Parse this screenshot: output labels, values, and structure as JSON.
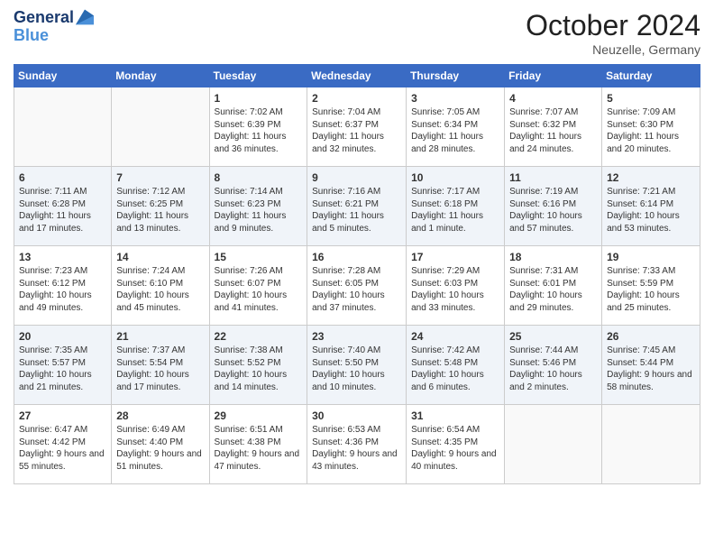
{
  "header": {
    "logo_line1": "General",
    "logo_line2": "Blue",
    "month": "October 2024",
    "location": "Neuzelle, Germany"
  },
  "weekdays": [
    "Sunday",
    "Monday",
    "Tuesday",
    "Wednesday",
    "Thursday",
    "Friday",
    "Saturday"
  ],
  "weeks": [
    [
      {
        "day": "",
        "info": ""
      },
      {
        "day": "",
        "info": ""
      },
      {
        "day": "1",
        "info": "Sunrise: 7:02 AM\nSunset: 6:39 PM\nDaylight: 11 hours and 36 minutes."
      },
      {
        "day": "2",
        "info": "Sunrise: 7:04 AM\nSunset: 6:37 PM\nDaylight: 11 hours and 32 minutes."
      },
      {
        "day": "3",
        "info": "Sunrise: 7:05 AM\nSunset: 6:34 PM\nDaylight: 11 hours and 28 minutes."
      },
      {
        "day": "4",
        "info": "Sunrise: 7:07 AM\nSunset: 6:32 PM\nDaylight: 11 hours and 24 minutes."
      },
      {
        "day": "5",
        "info": "Sunrise: 7:09 AM\nSunset: 6:30 PM\nDaylight: 11 hours and 20 minutes."
      }
    ],
    [
      {
        "day": "6",
        "info": "Sunrise: 7:11 AM\nSunset: 6:28 PM\nDaylight: 11 hours and 17 minutes."
      },
      {
        "day": "7",
        "info": "Sunrise: 7:12 AM\nSunset: 6:25 PM\nDaylight: 11 hours and 13 minutes."
      },
      {
        "day": "8",
        "info": "Sunrise: 7:14 AM\nSunset: 6:23 PM\nDaylight: 11 hours and 9 minutes."
      },
      {
        "day": "9",
        "info": "Sunrise: 7:16 AM\nSunset: 6:21 PM\nDaylight: 11 hours and 5 minutes."
      },
      {
        "day": "10",
        "info": "Sunrise: 7:17 AM\nSunset: 6:18 PM\nDaylight: 11 hours and 1 minute."
      },
      {
        "day": "11",
        "info": "Sunrise: 7:19 AM\nSunset: 6:16 PM\nDaylight: 10 hours and 57 minutes."
      },
      {
        "day": "12",
        "info": "Sunrise: 7:21 AM\nSunset: 6:14 PM\nDaylight: 10 hours and 53 minutes."
      }
    ],
    [
      {
        "day": "13",
        "info": "Sunrise: 7:23 AM\nSunset: 6:12 PM\nDaylight: 10 hours and 49 minutes."
      },
      {
        "day": "14",
        "info": "Sunrise: 7:24 AM\nSunset: 6:10 PM\nDaylight: 10 hours and 45 minutes."
      },
      {
        "day": "15",
        "info": "Sunrise: 7:26 AM\nSunset: 6:07 PM\nDaylight: 10 hours and 41 minutes."
      },
      {
        "day": "16",
        "info": "Sunrise: 7:28 AM\nSunset: 6:05 PM\nDaylight: 10 hours and 37 minutes."
      },
      {
        "day": "17",
        "info": "Sunrise: 7:29 AM\nSunset: 6:03 PM\nDaylight: 10 hours and 33 minutes."
      },
      {
        "day": "18",
        "info": "Sunrise: 7:31 AM\nSunset: 6:01 PM\nDaylight: 10 hours and 29 minutes."
      },
      {
        "day": "19",
        "info": "Sunrise: 7:33 AM\nSunset: 5:59 PM\nDaylight: 10 hours and 25 minutes."
      }
    ],
    [
      {
        "day": "20",
        "info": "Sunrise: 7:35 AM\nSunset: 5:57 PM\nDaylight: 10 hours and 21 minutes."
      },
      {
        "day": "21",
        "info": "Sunrise: 7:37 AM\nSunset: 5:54 PM\nDaylight: 10 hours and 17 minutes."
      },
      {
        "day": "22",
        "info": "Sunrise: 7:38 AM\nSunset: 5:52 PM\nDaylight: 10 hours and 14 minutes."
      },
      {
        "day": "23",
        "info": "Sunrise: 7:40 AM\nSunset: 5:50 PM\nDaylight: 10 hours and 10 minutes."
      },
      {
        "day": "24",
        "info": "Sunrise: 7:42 AM\nSunset: 5:48 PM\nDaylight: 10 hours and 6 minutes."
      },
      {
        "day": "25",
        "info": "Sunrise: 7:44 AM\nSunset: 5:46 PM\nDaylight: 10 hours and 2 minutes."
      },
      {
        "day": "26",
        "info": "Sunrise: 7:45 AM\nSunset: 5:44 PM\nDaylight: 9 hours and 58 minutes."
      }
    ],
    [
      {
        "day": "27",
        "info": "Sunrise: 6:47 AM\nSunset: 4:42 PM\nDaylight: 9 hours and 55 minutes."
      },
      {
        "day": "28",
        "info": "Sunrise: 6:49 AM\nSunset: 4:40 PM\nDaylight: 9 hours and 51 minutes."
      },
      {
        "day": "29",
        "info": "Sunrise: 6:51 AM\nSunset: 4:38 PM\nDaylight: 9 hours and 47 minutes."
      },
      {
        "day": "30",
        "info": "Sunrise: 6:53 AM\nSunset: 4:36 PM\nDaylight: 9 hours and 43 minutes."
      },
      {
        "day": "31",
        "info": "Sunrise: 6:54 AM\nSunset: 4:35 PM\nDaylight: 9 hours and 40 minutes."
      },
      {
        "day": "",
        "info": ""
      },
      {
        "day": "",
        "info": ""
      }
    ]
  ]
}
